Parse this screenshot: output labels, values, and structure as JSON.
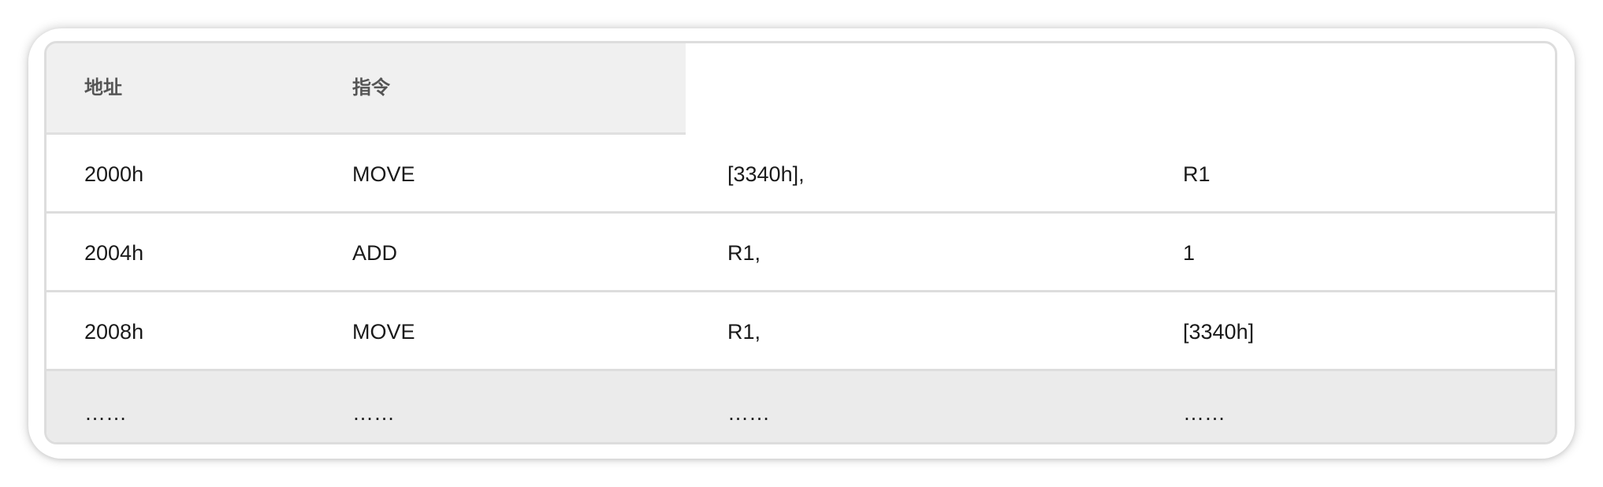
{
  "table": {
    "headers": [
      "地址",
      "指令"
    ],
    "rows": [
      [
        "2000h",
        "MOVE",
        "[3340h],",
        "R1"
      ],
      [
        "2004h",
        "ADD",
        "R1,",
        "1"
      ],
      [
        "2008h",
        "MOVE",
        "R1,",
        "[3340h]"
      ],
      [
        "……",
        "……",
        "……",
        "……"
      ]
    ]
  }
}
